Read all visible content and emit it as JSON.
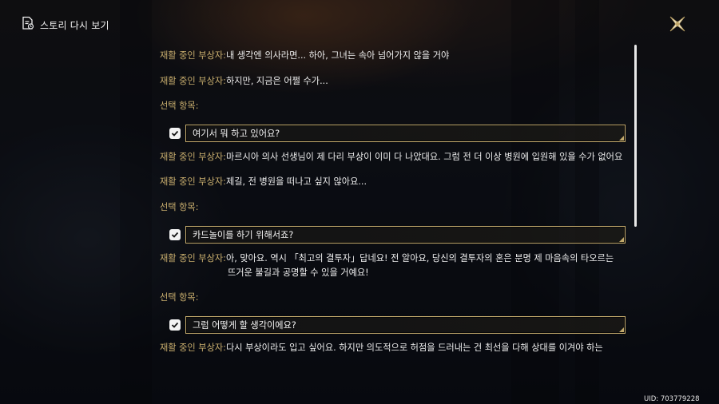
{
  "header": {
    "title": "스토리 다시 보기",
    "icon": "document-icon"
  },
  "close_icon": "close-x-icon",
  "log": [
    {
      "type": "line",
      "speaker": "재활 중인 부상자:",
      "text": "내 생각엔 의사라면... 하아, 그녀는 속아 넘어가지 않을 거야"
    },
    {
      "type": "line",
      "speaker": "재활 중인 부상자:",
      "text": "하지만, 지금은 어쩔 수가..."
    },
    {
      "type": "label",
      "text": "선택 항목:"
    },
    {
      "type": "choice",
      "text": "여기서 뭐 하고 있어요?",
      "checked": true
    },
    {
      "type": "line",
      "speaker": "재활 중인 부상자:",
      "text": "마르시아 의사 선생님이 제 다리 부상이 이미 다 나았대요. 그럼 전 더 이상 병원에 입원해 있을 수가 없어요"
    },
    {
      "type": "line",
      "speaker": "재활 중인 부상자:",
      "text": "제길, 전 병원을 떠나고 싶지 않아요..."
    },
    {
      "type": "label",
      "text": "선택 항목:"
    },
    {
      "type": "choice",
      "text": "카드놀이를 하기 위해서죠?",
      "checked": true
    },
    {
      "type": "line",
      "speaker": "재활 중인 부상자:",
      "text": "아, 맞아요. 역시 「최고의 결투자」답네요! 전 알아요, 당신의 결투자의 혼은 분명 제 마음속의 타오르는",
      "cont": "뜨거운 불길과 공명할 수 있을 거예요!"
    },
    {
      "type": "label",
      "text": "선택 항목:"
    },
    {
      "type": "choice",
      "text": "그럼 어떻게 할 생각이에요?",
      "checked": true
    },
    {
      "type": "line",
      "speaker": "재활 중인 부상자:",
      "text": "다시 부상이라도 입고 싶어요. 하지만 의도적으로 허점을 드러내는 건 최선을 다해 상대를 이겨야 하는"
    }
  ],
  "uid": "UID: 703779228",
  "colors": {
    "speaker": "#c9ae6e",
    "choice_border": "#c2a96b",
    "text": "#eeeeee"
  }
}
